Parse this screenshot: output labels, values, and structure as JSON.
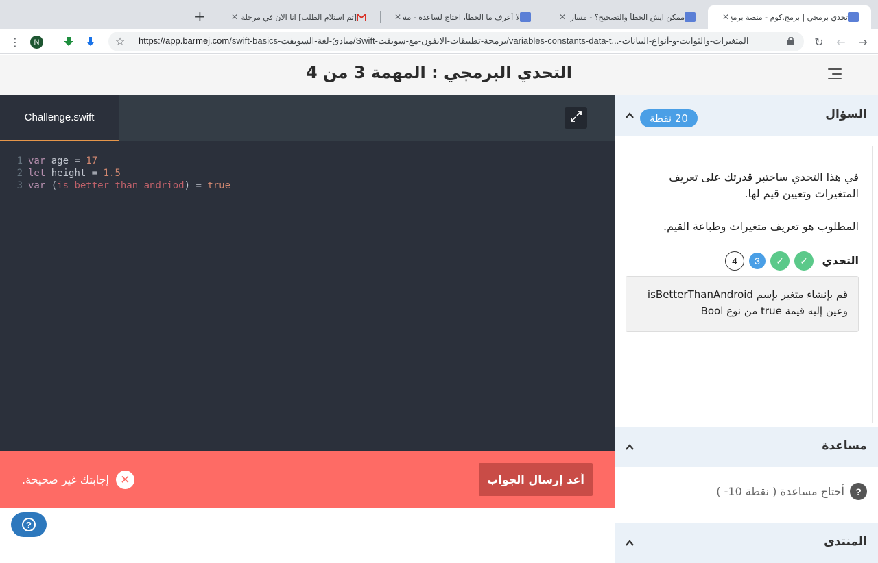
{
  "browser": {
    "tabs": [
      {
        "title": "[تم استلام الطلب] انا الان في مرحلة ript",
        "favicon": "gmail-icon",
        "active": false
      },
      {
        "title": "لا أعرف ما الخطأ، احتاج لساعدة - مسار",
        "favicon": "barmej-icon",
        "active": false
      },
      {
        "title": "ممكن ايش الخطأ والتصحيح؟ - مسار برم",
        "favicon": "barmej-icon",
        "active": false
      },
      {
        "title": "تحدي برمجي | برمج.كوم - منصة برمج لت",
        "favicon": "barmej-icon",
        "active": true
      }
    ],
    "new_tab_label": "+",
    "profile_initial": "N",
    "url_host": "https://app.barmej.com",
    "url_path": "/swift-basics-مبادئ-لغة-السويفت/Swift-برمجة-تطبيقات-الايفون-مع-سويفت/variables-constants-data-t...-المتغيرات-والثوابت-و-أنواع-البيانات"
  },
  "header": {
    "title": "التحدي البرمجي : المهمة 3 من 4"
  },
  "editor": {
    "file_name": "Challenge.swift",
    "lines": [
      {
        "num": "1",
        "tokens": [
          {
            "t": "var",
            "c": "kw"
          },
          {
            "t": " age = ",
            "c": "var"
          },
          {
            "t": "17",
            "c": "num"
          }
        ]
      },
      {
        "num": "2",
        "tokens": [
          {
            "t": "let",
            "c": "kw"
          },
          {
            "t": " height = ",
            "c": "var"
          },
          {
            "t": "1.5",
            "c": "num"
          }
        ]
      },
      {
        "num": "3",
        "tokens": [
          {
            "t": "var",
            "c": "kw"
          },
          {
            "t": " (",
            "c": "var"
          },
          {
            "t": "is better than andriod",
            "c": "err"
          },
          {
            "t": ") = ",
            "c": "var"
          },
          {
            "t": "true",
            "c": "bool"
          }
        ]
      }
    ]
  },
  "result": {
    "resubmit_label": "أعد إرسال الجواب",
    "wrong_message": "إجابتك غير صحيحة."
  },
  "question": {
    "section_title": "السؤال",
    "points": "20 نقطة",
    "description_1": "في هذا التحدي ساختبر قدرتك على تعريف المتغيرات وتعيين قيم لها.",
    "description_2": "المطلوب هو تعريف متغيرات وطباعة القيم.",
    "challenge_label": "التحدي",
    "steps": [
      "✓",
      "✓",
      "3",
      "4"
    ],
    "task_line1": "قم بإنشاء متغير بإسم isBetterThanAndroid",
    "task_line2": "وعين إليه قيمة true من نوع Bool"
  },
  "help": {
    "section_title": "مساعدة",
    "need_help": "أحتاج مساعدة ( نقطة 10- )"
  },
  "forum": {
    "section_title": "المنتدى"
  },
  "colors": {
    "accent_blue": "#4a9fe6",
    "error_bar": "#fe6b65",
    "success_green": "#5bc98a",
    "editor_bg": "#2b303b"
  }
}
